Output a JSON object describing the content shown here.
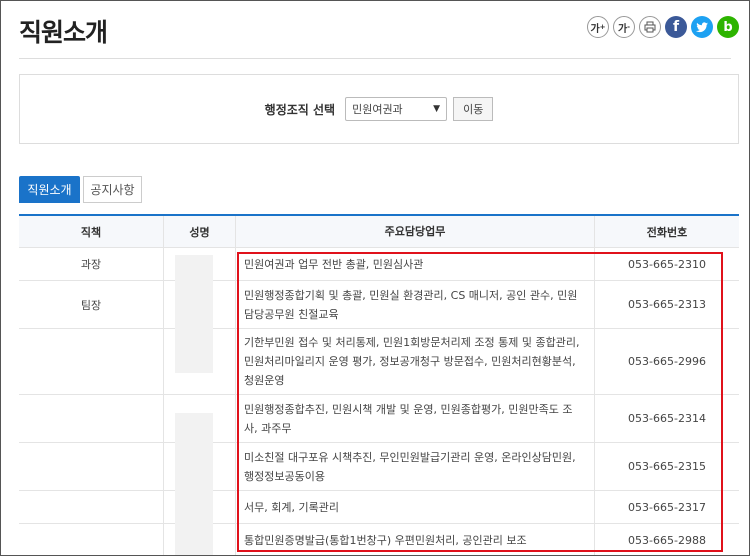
{
  "header": {
    "title": "직원소개",
    "tools": [
      {
        "icon": "font-increase-icon",
        "label": "가"
      },
      {
        "icon": "font-decrease-icon",
        "label": "가"
      },
      {
        "icon": "print-icon"
      },
      {
        "icon": "facebook-icon",
        "label": "f"
      },
      {
        "icon": "twitter-icon"
      },
      {
        "icon": "blog-icon",
        "label": "b"
      }
    ]
  },
  "filter": {
    "label": "행정조직 선택",
    "selected": "민원여권과",
    "button": "이동"
  },
  "tabs": [
    {
      "label": "직원소개",
      "active": true
    },
    {
      "label": "공지사항",
      "active": false
    }
  ],
  "table": {
    "headers": [
      "직책",
      "성명",
      "주요담당업무",
      "전화번호"
    ],
    "rows": [
      {
        "position": "과장",
        "duty": "민원여권과 업무 전반 총괄, 민원심사관",
        "phone": "053-665-2310"
      },
      {
        "position": "팀장",
        "duty": "민원행정종합기획 및 총괄, 민원실 환경관리, CS 매니저, 공인 관수, 민원담당공무원 친절교육",
        "phone": "053-665-2313"
      },
      {
        "position": "",
        "duty": "기한부민원 접수 및 처리통제, 민원1회방문처리제 조정 통제 및 종합관리, 민원처리마일리지 운영 평가, 정보공개청구 방문접수, 민원처리현황분석, 청원운영",
        "phone": "053-665-2996"
      },
      {
        "position": "",
        "duty": "민원행정종합추진, 민원시책 개발 및 운영, 민원종합평가, 민원만족도 조사, 과주무",
        "phone": "053-665-2314"
      },
      {
        "position": "",
        "duty": "미소친절 대구포유 시책추진, 무인민원발급기관리 운영, 온라인상담민원, 행정정보공동이용",
        "phone": "053-665-2315"
      },
      {
        "position": "",
        "duty": "서무, 회계, 기록관리",
        "phone": "053-665-2317"
      },
      {
        "position": "",
        "duty": "통합민원증명발급(통합1번창구) 우편민원처리, 공인관리 보조",
        "phone": "053-665-2988"
      }
    ]
  },
  "colors": {
    "accent": "#1a73c9",
    "highlight": "#e0111b"
  }
}
